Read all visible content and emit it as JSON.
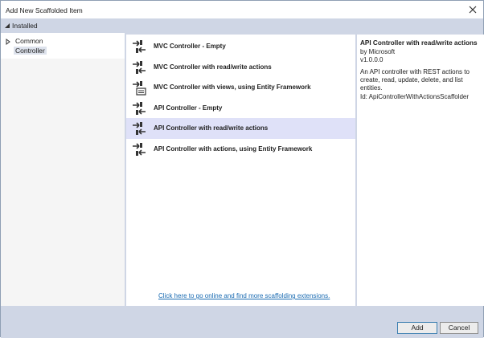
{
  "window": {
    "title": "Add New Scaffolded Item"
  },
  "installed": {
    "label": "Installed"
  },
  "tree": {
    "items": [
      {
        "label": "Common"
      },
      {
        "label": "Controller"
      }
    ]
  },
  "templates": {
    "items": [
      {
        "label": "MVC Controller - Empty"
      },
      {
        "label": "MVC Controller with read/write actions"
      },
      {
        "label": "MVC Controller with views, using Entity Framework"
      },
      {
        "label": "API Controller - Empty"
      },
      {
        "label": "API Controller with read/write actions"
      },
      {
        "label": "API Controller with actions, using Entity Framework"
      }
    ],
    "selected_index": 4,
    "online_link": "Click here to go online and find more scaffolding extensions."
  },
  "details": {
    "title": "API Controller with read/write actions",
    "author": "by Microsoft",
    "version": "v1.0.0.0",
    "description": "An API controller with REST actions to create, read, update, delete, and list entities.",
    "id": "Id: ApiControllerWithActionsScaffolder"
  },
  "footer": {
    "add_label": "Add",
    "cancel_label": "Cancel"
  },
  "colors": {
    "header_bar": "#cfd6e5",
    "selection": "#dfe1f8",
    "link": "#1a6bb2"
  },
  "icons": {
    "template_icon": "controller-arrows-icon",
    "close": "close-icon",
    "expand": "collapse-triangle-icon"
  }
}
